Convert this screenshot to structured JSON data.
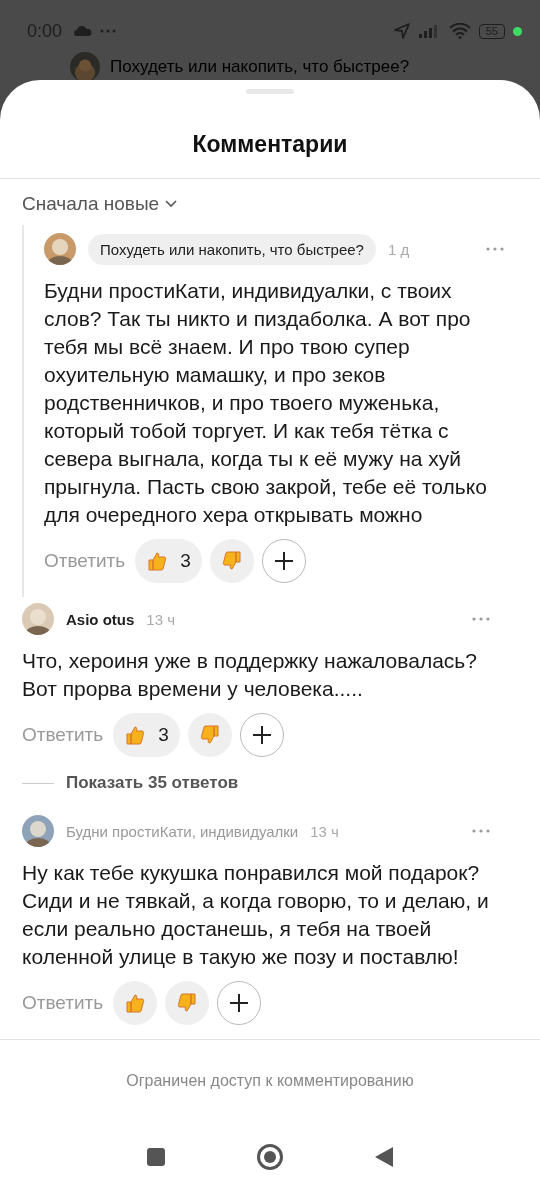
{
  "status_bar": {
    "time": "0:00",
    "battery": "55"
  },
  "background_header": {
    "title": "Похудеть или накопить, что быстрее?"
  },
  "sheet": {
    "title": "Комментарии",
    "sort": "Сначала новые"
  },
  "comments": [
    {
      "kind": "article",
      "nested": true,
      "author": "Похудеть или накопить, что быстрее?",
      "time": "1 д",
      "text": "Будни простиКати, индивидуалки, с твоих слов? Так ты никто и пиздаболка. А вот про тебя мы всё знаем. И про твою супер охуительную мамашку, и про зеков родственничков, и про твоего муженька, который тобой торгует. И как тебя тётка с севера выгнала, когда ты к её мужу на хуй прыгнула. Пасть свою закрой, тебе её только для очередного хера открывать можно",
      "reply": "Ответить",
      "likes": "3"
    },
    {
      "kind": "user",
      "nested": false,
      "author": "Asio otus",
      "time": "13 ч",
      "text": "Что, хероиня уже в поддержку нажаловалась? Вот прорва времени у человека.....",
      "reply": "Ответить",
      "likes": "3",
      "show_replies": "Показать 35 ответов"
    },
    {
      "kind": "channel",
      "nested": false,
      "author": "Будни простиКати, индивидуалки",
      "time": "13 ч",
      "text": "Ну как тебе кукушка понравился мой подарок? Сиди и не тявкай, а когда говорю, то и делаю, и если реально достанешь, я тебя на твоей коленной улице в такую же позу и поставлю!",
      "reply": "Ответить"
    }
  ],
  "footer": "Ограничен доступ к комментированию"
}
